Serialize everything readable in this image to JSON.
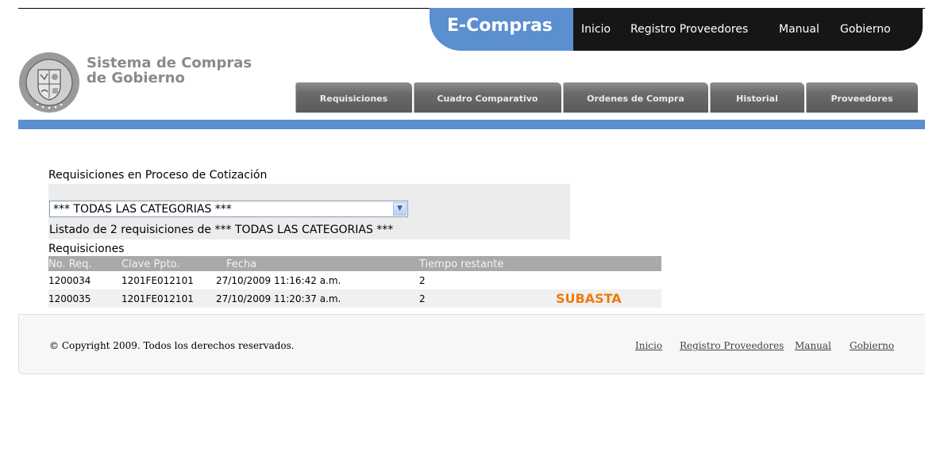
{
  "header": {
    "brand": "E-Compras",
    "site_title_line1": "Sistema de Compras",
    "site_title_line2": "de Gobierno",
    "nav": [
      "Inicio",
      "Registro Proveedores",
      "Manual",
      "Gobierno"
    ],
    "tabs": [
      "Requisiciones",
      "Cuadro Comparativo",
      "Ordenes de Compra",
      "Historial",
      "Proveedores"
    ]
  },
  "main": {
    "section_title": "Requisiciones en Proceso de Cotización",
    "category_select": "*** TODAS LAS CATEGORIAS ***",
    "listing_text": "Listado de 2 requisiciones de *** TODAS LAS CATEGORIAS ***",
    "table_label": "Requisiciones",
    "table": {
      "headers": [
        "No. Req.",
        "Clave Ppto.",
        "Fecha",
        "Tiempo restante"
      ],
      "rows": [
        {
          "no_req": "1200034",
          "clave": "1201FE012101",
          "fecha": "27/10/2009 11:16:42 a.m.",
          "tiempo": "2",
          "badge": ""
        },
        {
          "no_req": "1200035",
          "clave": "1201FE012101",
          "fecha": "27/10/2009 11:20:37 a.m.",
          "tiempo": "2",
          "badge": "SUBASTA"
        }
      ]
    }
  },
  "footer": {
    "copyright": "© Copyright 2009. Todos los derechos reservados.",
    "links": [
      "Inicio",
      "Registro Proveedores",
      "Manual",
      "Gobierno"
    ]
  },
  "colors": {
    "accent_blue": "#5b8fd0",
    "nav_black": "#161616",
    "tab_gray": "#6b6b6b",
    "badge_orange": "#f07a10"
  },
  "icons": {
    "seal": "state-seal-icon",
    "select_arrow": "chevron-down-icon"
  }
}
